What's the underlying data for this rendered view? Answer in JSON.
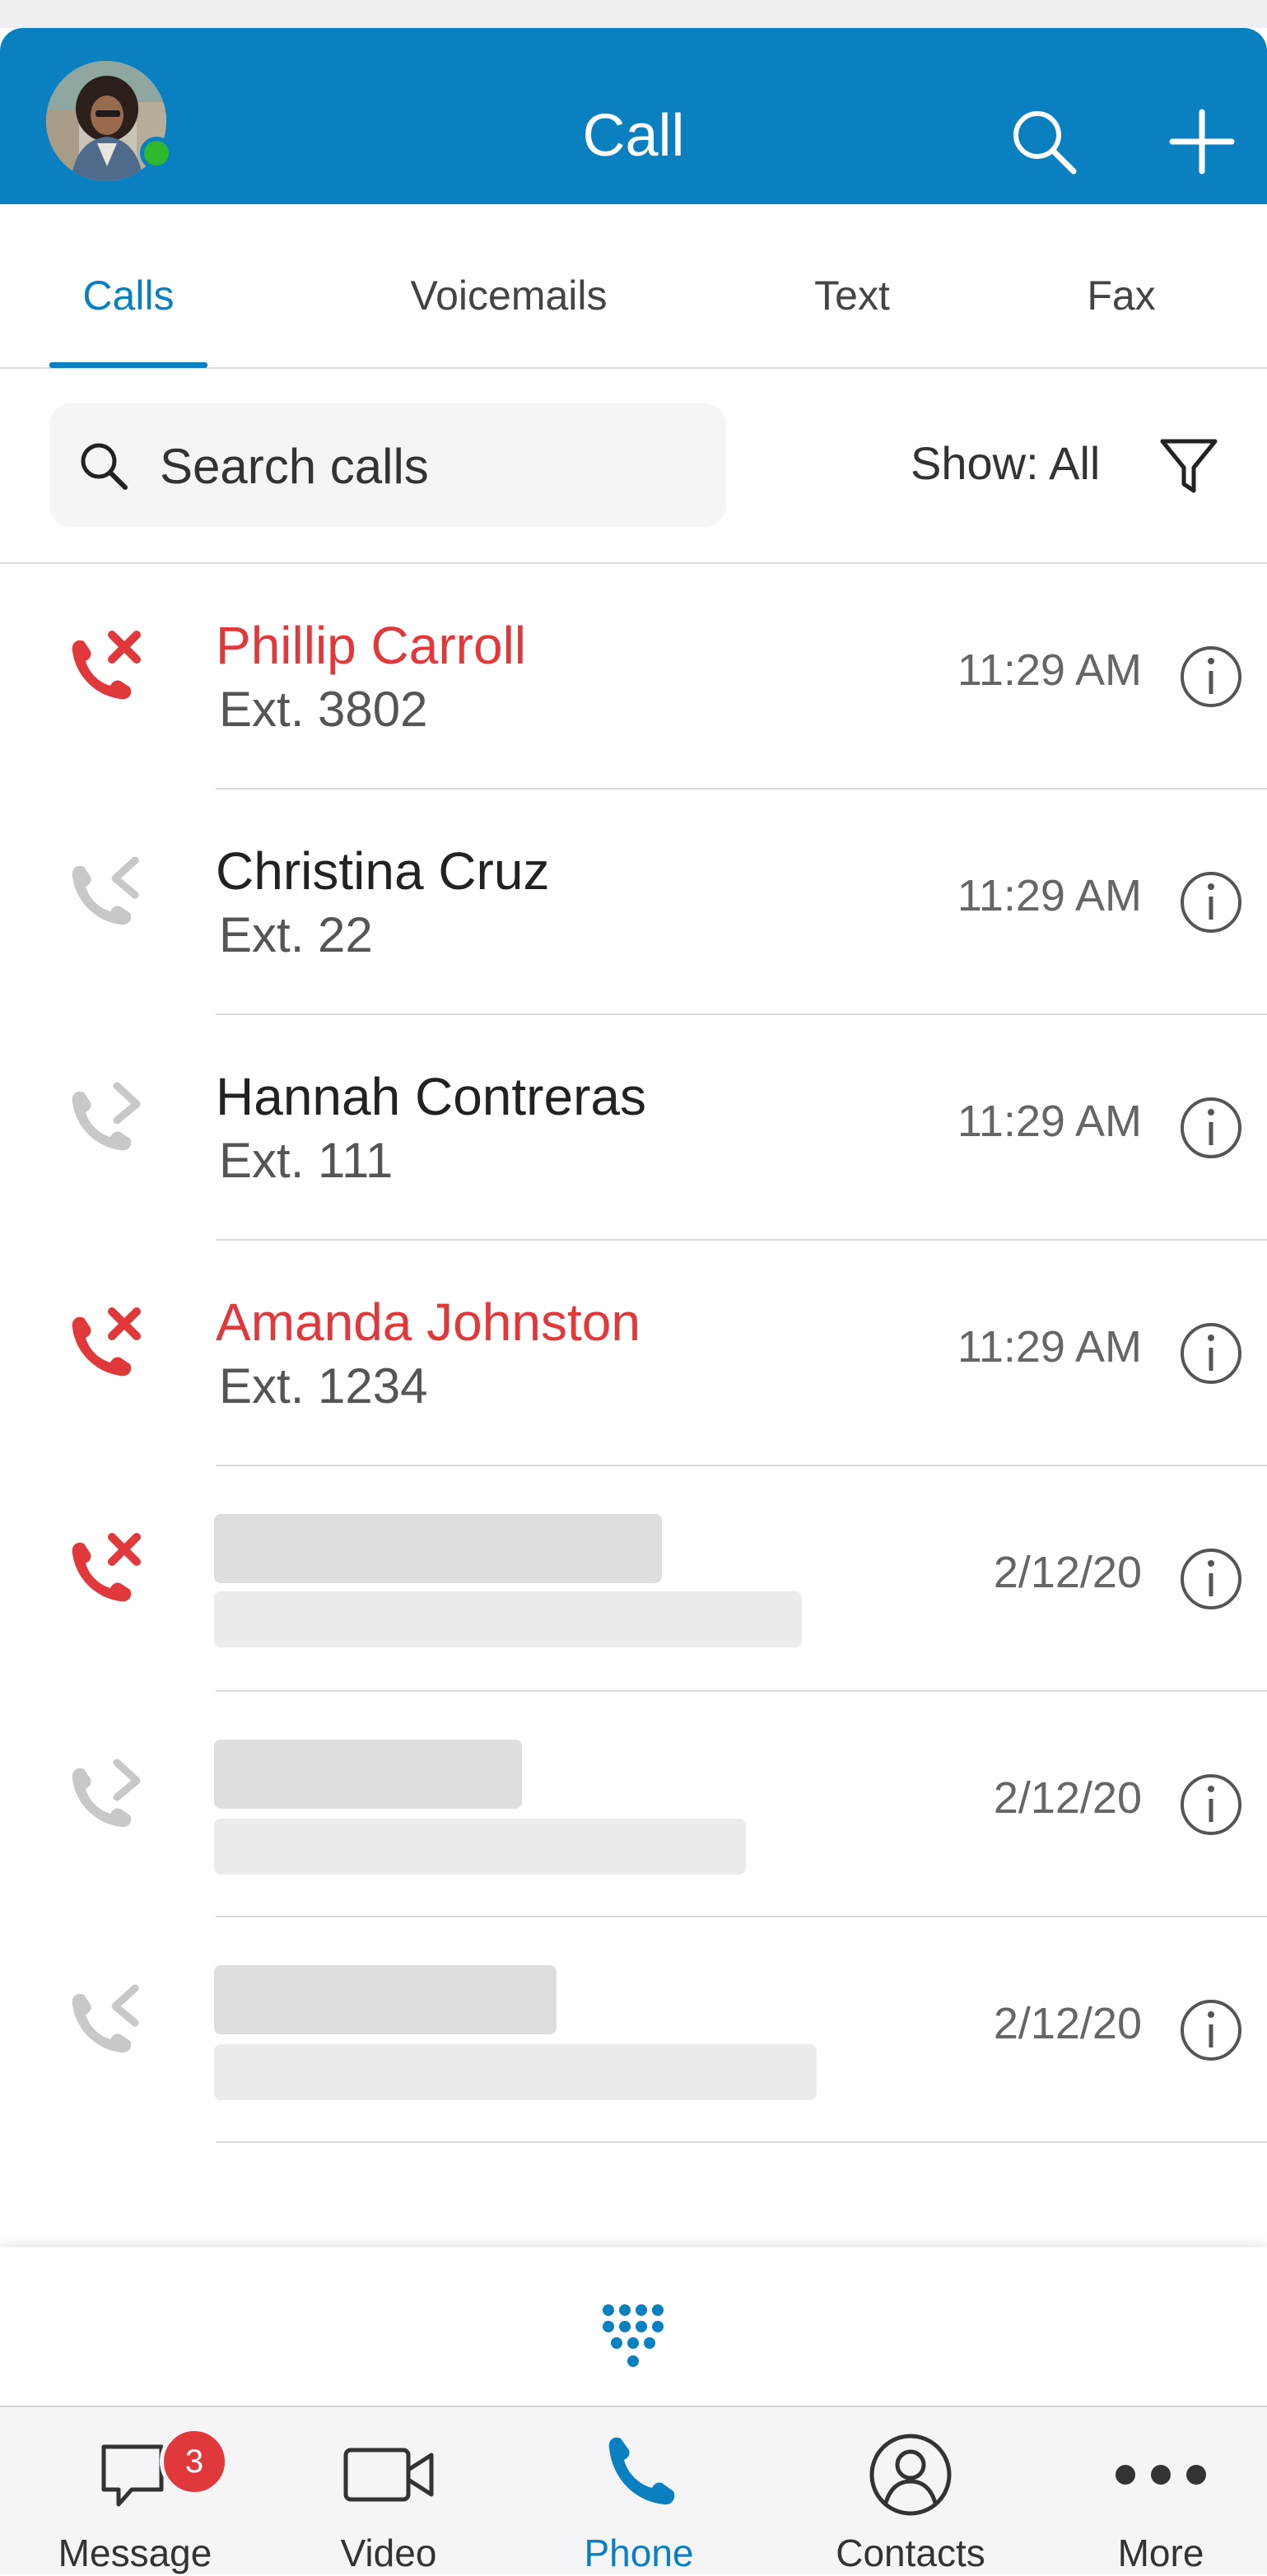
{
  "header": {
    "title": "Call",
    "accent_color": "#0a80c0"
  },
  "tabs": [
    {
      "label": "Calls",
      "active": true
    },
    {
      "label": "Voicemails",
      "active": false
    },
    {
      "label": "Text",
      "active": false
    },
    {
      "label": "Fax",
      "active": false
    }
  ],
  "search": {
    "placeholder": "Search calls"
  },
  "filter": {
    "label": "Show: All"
  },
  "calls": [
    {
      "name": "Phillip Carroll",
      "ext": "Ext. 3802",
      "time": "11:29 AM",
      "type": "missed"
    },
    {
      "name": "Christina Cruz",
      "ext": "Ext. 22",
      "time": "11:29 AM",
      "type": "incoming"
    },
    {
      "name": "Hannah Contreras",
      "ext": "Ext. 111",
      "time": "11:29 AM",
      "type": "outgoing"
    },
    {
      "name": "Amanda Johnston",
      "ext": "Ext. 1234",
      "time": "11:29 AM",
      "type": "missed"
    },
    {
      "time": "2/12/20",
      "type": "missed",
      "placeholder": true
    },
    {
      "time": "2/12/20",
      "type": "outgoing",
      "placeholder": true
    },
    {
      "time": "2/12/20",
      "type": "incoming",
      "placeholder": true
    }
  ],
  "bottom_nav": [
    {
      "label": "Message",
      "icon": "message-icon",
      "badge": "3"
    },
    {
      "label": "Video",
      "icon": "video-icon"
    },
    {
      "label": "Phone",
      "icon": "phone-icon",
      "active": true
    },
    {
      "label": "Contacts",
      "icon": "contacts-icon"
    },
    {
      "label": "More",
      "icon": "more-icon"
    }
  ],
  "colors": {
    "missed": "#e0383b",
    "neutral_icon": "#c8c8c8",
    "online": "#2fb72f"
  }
}
